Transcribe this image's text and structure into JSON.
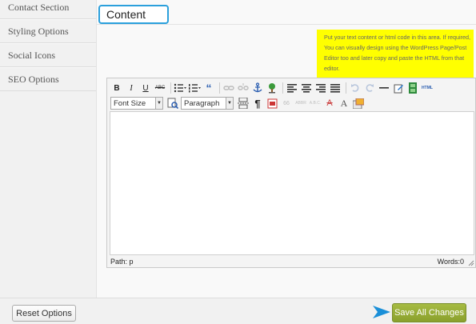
{
  "sidebar": {
    "items": [
      {
        "label": "Contact Section"
      },
      {
        "label": "Styling Options"
      },
      {
        "label": "Social Icons"
      },
      {
        "label": "SEO Options"
      }
    ]
  },
  "main": {
    "tab_label": "Content",
    "hint_text": "Put your text content or html code in this area. If required, You can visually design using the WordPress Page/Post Editor too and later copy and paste the HTML from that editor."
  },
  "editor": {
    "toolbar": {
      "font_size_label": "Font Size",
      "format_label": "Paragraph",
      "html_label": "HTML",
      "bold": "B",
      "italic": "I",
      "underline": "U",
      "strike": "ABC",
      "quote": "“",
      "pilcrow": "¶",
      "cite": "66",
      "abbr": "ABBR",
      "acronym": "A.B.C.",
      "strike_a": "A",
      "font_a": "A"
    },
    "content": "",
    "path": "Path: p",
    "words": "Words:0"
  },
  "footer": {
    "reset_label": "Reset Options",
    "save_label": "Save All Changes"
  },
  "colors": {
    "tab_border": "#2ba0dc",
    "hint_bg": "#ffff00",
    "save_bg": "#98ad37",
    "arrow": "#1a8fd8"
  }
}
